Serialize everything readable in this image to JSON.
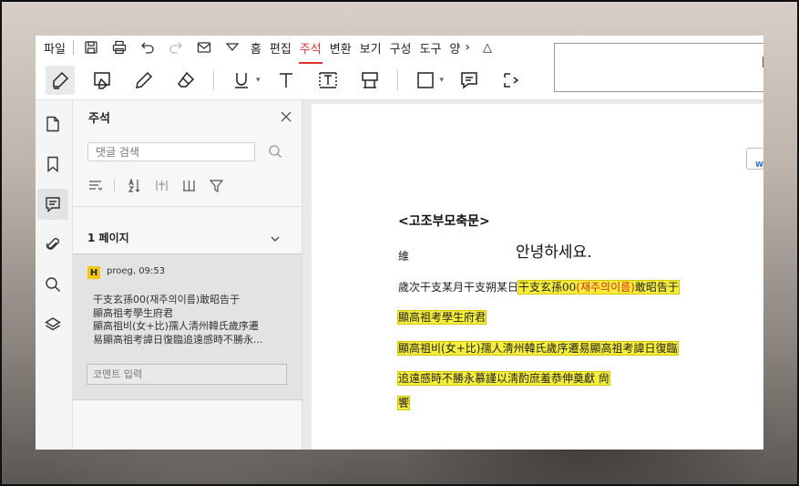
{
  "menu": {
    "file_label": "파일",
    "tabs": [
      {
        "label": "홈"
      },
      {
        "label": "편집"
      },
      {
        "label": "주석"
      },
      {
        "label": "변환"
      },
      {
        "label": "보기"
      },
      {
        "label": "구성"
      },
      {
        "label": "도구"
      },
      {
        "label": "양"
      }
    ],
    "active_tab": "주석",
    "more_glyph": "›",
    "collapse_glyph": "△"
  },
  "toolbar": {
    "tools": [
      "highlight-icon",
      "area-highlight-icon",
      "pencil-icon",
      "eraser-icon",
      "underline-icon",
      "typewriter-icon",
      "textbox-icon",
      "callout-icon",
      "shape-icon",
      "note-icon",
      "more-icon"
    ]
  },
  "rail": {
    "items": [
      "page-icon",
      "bookmark-icon",
      "comment-icon",
      "attachment-icon",
      "search-icon",
      "layers-icon"
    ],
    "active": "comment-icon"
  },
  "panel": {
    "title": "주석",
    "search_placeholder": "댓글 검색",
    "page_label": "1 페이지",
    "annotation": {
      "badge": "H",
      "author": "proeg,",
      "time": "09:53",
      "lines": [
        "干支玄孫00(재주의이름)敢昭告于",
        "顯高祖考學生府君",
        "顯高祖비(女+比)孺人淸州韓氏歲序遷",
        "易顯高祖考諱日復臨追遠感時不勝永..."
      ],
      "reply_placeholder": "코멘트 입력"
    }
  },
  "document": {
    "title": "<고조부모축문>",
    "line_wei": "維",
    "hello": "안녕하세요.",
    "line1_plain": "歲次干支某月干支朔某日",
    "line1_hl_a": "干支玄孫00",
    "line1_hl_red": "(재주의이름)",
    "line1_hl_b": "敢昭告于",
    "line2": "顯高祖考學生府君",
    "line3_a": "顯高祖",
    "line3_b": "비(女+比)",
    "line3_c": "孺人淸州韓氏歲序遷易顯高祖考諱日復臨",
    "line4": "追遠感時不勝永慕謹以淸酌庶羞恭伸奠獻  尙",
    "line5": "饗"
  },
  "colors": {
    "accent": "#d9342b",
    "highlight": "#f6ee3c",
    "badge": "#f2c814"
  }
}
